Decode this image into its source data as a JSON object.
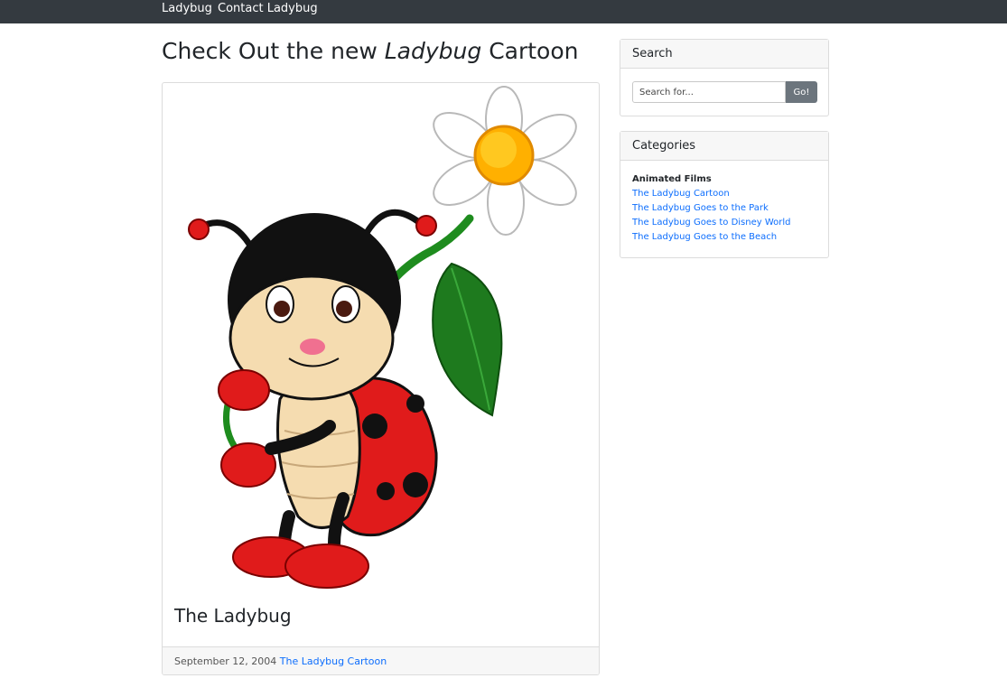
{
  "nav": {
    "brand": "Ladybug",
    "contact": "Contact Ladybug"
  },
  "main": {
    "title_prefix": "Check Out the new",
    "title_emphasis": "Ladybug",
    "title_suffix": "Cartoon",
    "post": {
      "image_icon": "ladybug-holding-daisy-illustration",
      "title": "The Ladybug",
      "date": "September 12, 2004",
      "link": "The Ladybug Cartoon"
    }
  },
  "sidebar": {
    "search": {
      "header": "Search",
      "placeholder": "Search for...",
      "button": "Go!"
    },
    "categories": {
      "header": "Categories",
      "heading": "Animated Films",
      "items": [
        "The Ladybug Cartoon",
        "The Ladybug Goes to the Park",
        "The Ladybug Goes to Disney World",
        "The Ladybug Goes to the Beach"
      ]
    }
  },
  "colors": {
    "navbar": "#343a40",
    "link": "#0d6efd",
    "button": "#6c757d"
  }
}
